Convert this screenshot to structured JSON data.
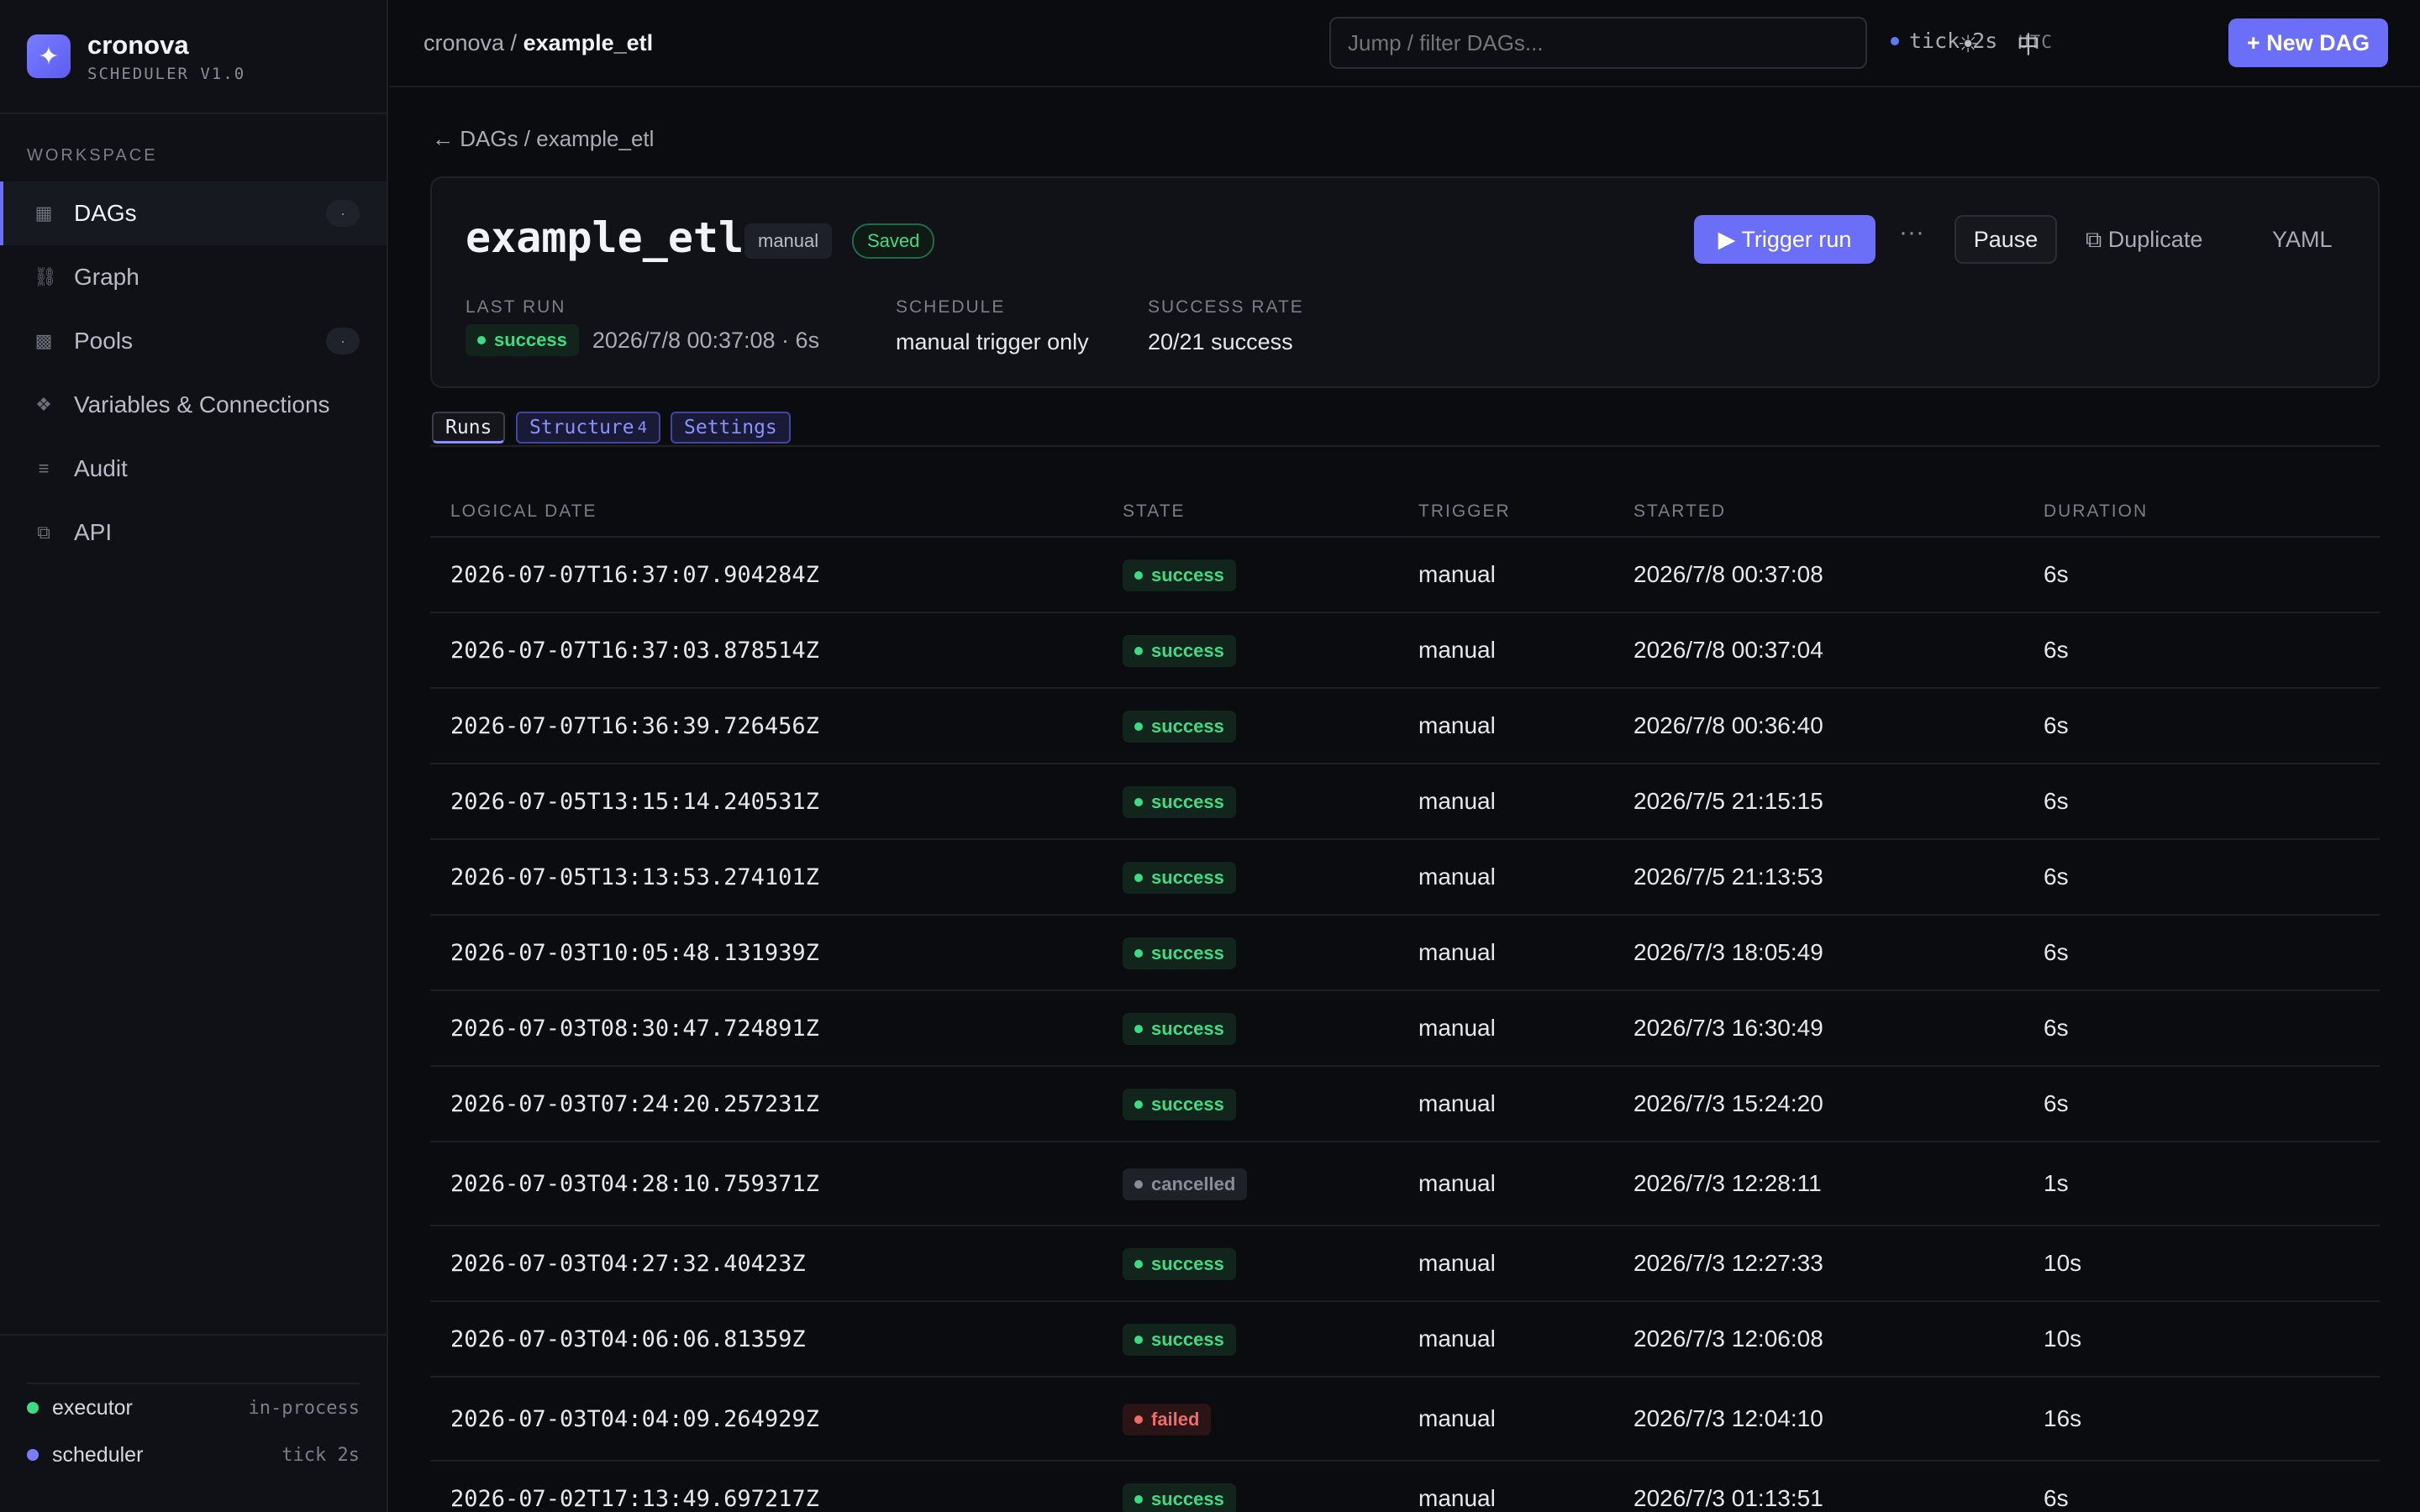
{
  "app": {
    "name": "cronova",
    "subtitle": "SCHEDULER V1.0",
    "logo_icon": "sparkle-icon"
  },
  "sidebar": {
    "section_label": "WORKSPACE",
    "items": [
      {
        "label": "DAGs",
        "icon": "grid-icon",
        "count": "·",
        "active": true
      },
      {
        "label": "Graph",
        "icon": "link-icon",
        "count": "",
        "active": false
      },
      {
        "label": "Pools",
        "icon": "square-icon",
        "count": "·",
        "active": false
      },
      {
        "label": "Variables & Connections",
        "icon": "diamond-icon",
        "count": "",
        "active": false
      },
      {
        "label": "Audit",
        "icon": "list-icon",
        "count": "",
        "active": false
      },
      {
        "label": "API",
        "icon": "copy-icon",
        "count": "",
        "active": false
      }
    ],
    "processes": [
      {
        "name": "executor",
        "value": "in-process",
        "color": "#3ddc84"
      },
      {
        "name": "scheduler",
        "value": "tick 2s",
        "color": "#7a7cff"
      }
    ]
  },
  "topbar": {
    "crumb_root": "cronova /",
    "crumb_current": "example_etl",
    "search_placeholder": "Jump / filter DAGs...",
    "tick": "tick 2s",
    "tz": "UTC",
    "theme_icon": "☀",
    "lang": "中",
    "new_dag": "+ New DAG"
  },
  "dag": {
    "back": "← DAGs / example_etl",
    "name": "example_etl",
    "mode_chip": "manual",
    "saved_chip": "Saved",
    "trigger_label": "▶ Trigger run",
    "more_label": "···",
    "pause_label": "Pause",
    "duplicate_label": "⧉ Duplicate",
    "yaml_label": "YAML",
    "last_run_label": "LAST RUN",
    "last_run_state": "success",
    "last_run_time": "2026/7/8 00:37:08 · 6s",
    "schedule_label": "SCHEDULE",
    "schedule_value": "manual trigger only",
    "success_rate_label": "SUCCESS RATE",
    "success_rate_value": "20/21 success"
  },
  "tabs": {
    "runs": "Runs",
    "structure": "Structure",
    "structure_count": "4",
    "settings": "Settings"
  },
  "table": {
    "headers": [
      "LOGICAL DATE",
      "STATE",
      "TRIGGER",
      "STARTED",
      "DURATION"
    ],
    "rows": [
      {
        "date": "2026-07-07T16:37:07.904284Z",
        "state": "success",
        "trigger": "manual",
        "started": "2026/7/8 00:37:08",
        "duration": "6s"
      },
      {
        "date": "2026-07-07T16:37:03.878514Z",
        "state": "success",
        "trigger": "manual",
        "started": "2026/7/8 00:37:04",
        "duration": "6s"
      },
      {
        "date": "2026-07-07T16:36:39.726456Z",
        "state": "success",
        "trigger": "manual",
        "started": "2026/7/8 00:36:40",
        "duration": "6s"
      },
      {
        "date": "2026-07-05T13:15:14.240531Z",
        "state": "success",
        "trigger": "manual",
        "started": "2026/7/5 21:15:15",
        "duration": "6s"
      },
      {
        "date": "2026-07-05T13:13:53.274101Z",
        "state": "success",
        "trigger": "manual",
        "started": "2026/7/5 21:13:53",
        "duration": "6s"
      },
      {
        "date": "2026-07-03T10:05:48.131939Z",
        "state": "success",
        "trigger": "manual",
        "started": "2026/7/3 18:05:49",
        "duration": "6s"
      },
      {
        "date": "2026-07-03T08:30:47.724891Z",
        "state": "success",
        "trigger": "manual",
        "started": "2026/7/3 16:30:49",
        "duration": "6s"
      },
      {
        "date": "2026-07-03T07:24:20.257231Z",
        "state": "success",
        "trigger": "manual",
        "started": "2026/7/3 15:24:20",
        "duration": "6s"
      },
      {
        "date": "2026-07-03T04:28:10.759371Z",
        "state": "cancelled",
        "trigger": "manual",
        "started": "2026/7/3 12:28:11",
        "duration": "1s"
      },
      {
        "date": "2026-07-03T04:27:32.40423Z",
        "state": "success",
        "trigger": "manual",
        "started": "2026/7/3 12:27:33",
        "duration": "10s"
      },
      {
        "date": "2026-07-03T04:06:06.81359Z",
        "state": "success",
        "trigger": "manual",
        "started": "2026/7/3 12:06:08",
        "duration": "10s"
      },
      {
        "date": "2026-07-03T04:04:09.264929Z",
        "state": "failed",
        "trigger": "manual",
        "started": "2026/7/3 12:04:10",
        "duration": "16s"
      },
      {
        "date": "2026-07-02T17:13:49.697217Z",
        "state": "success",
        "trigger": "manual",
        "started": "2026/7/3 01:13:51",
        "duration": "6s"
      }
    ]
  },
  "colors": {
    "accent": "#6b6ef7",
    "success": "#3ddc84",
    "failed": "#f26a6a",
    "cancelled": "#8a8d98",
    "background": "#0b0c10"
  }
}
